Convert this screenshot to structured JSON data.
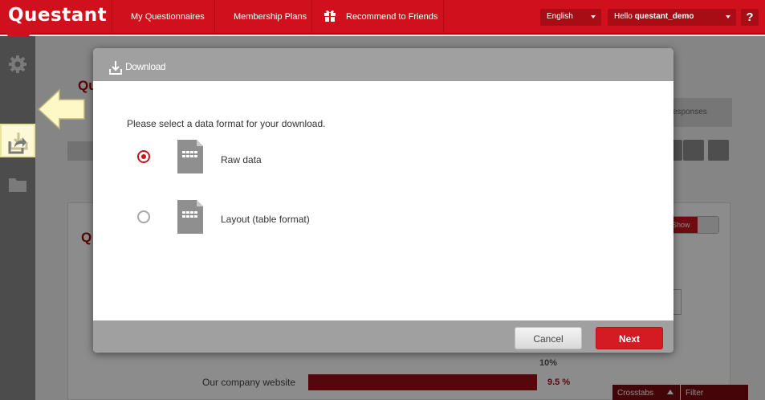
{
  "topbar": {
    "logo": "Questant",
    "nav": [
      "My Questionnaires",
      "Membership Plans",
      "Recommend to Friends"
    ],
    "language": "English",
    "user_greeting": "Hello questant_demo",
    "help": "?"
  },
  "background": {
    "title_fragment": "Qu",
    "tab_fragment": "esponses",
    "question_fragment": "Q",
    "toggle_label": "Show",
    "pct_header": "10%",
    "row_label": "Our company website",
    "row_pct": "9.5 %",
    "row_fraction": 0.095,
    "crosstabs": "Crosstabs",
    "filter": "Filter"
  },
  "modal": {
    "title": "Download",
    "prompt": "Please select a data format for your download.",
    "options": [
      {
        "label": "Raw data",
        "selected": true
      },
      {
        "label": "Layout (table format)",
        "selected": false
      }
    ],
    "cancel": "Cancel",
    "next": "Next"
  },
  "colors": {
    "brand_red": "#d0101c",
    "button_red": "#d41a22",
    "header_gray": "#a0a0a0"
  }
}
